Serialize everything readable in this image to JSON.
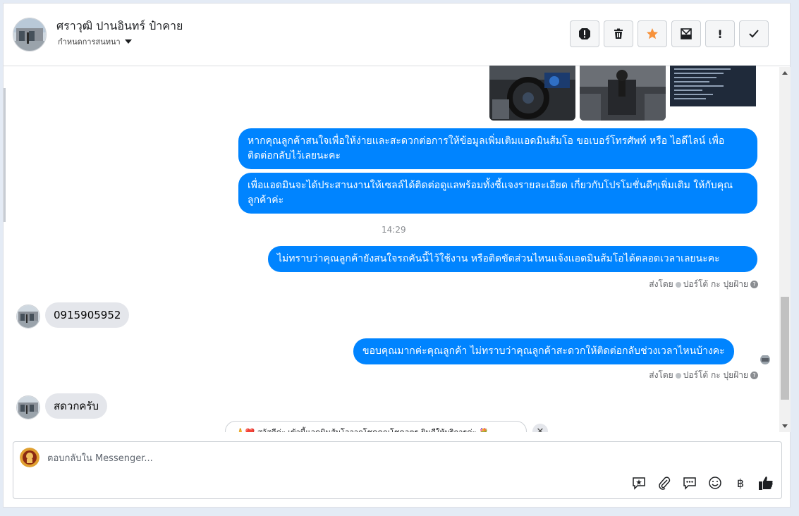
{
  "header": {
    "contact_name": "ศราวุฒิ ปานอินทร์ ป๋าคาย",
    "assign_label": "กำหนดการสนทนา",
    "actions": [
      {
        "name": "spam-button",
        "icon": "alert-octagon-icon",
        "glyph": "!"
      },
      {
        "name": "delete-button",
        "icon": "trash-icon",
        "glyph": "🗑"
      },
      {
        "name": "star-button",
        "icon": "star-icon",
        "glyph": "★"
      },
      {
        "name": "mark-unread-button",
        "icon": "envelope-icon",
        "glyph": "✉"
      },
      {
        "name": "follow-up-button",
        "icon": "exclamation-icon",
        "glyph": "!"
      },
      {
        "name": "done-button",
        "icon": "check-icon",
        "glyph": "✓"
      }
    ]
  },
  "colors": {
    "brand_blue": "#0084ff",
    "incoming_bubble": "#e4e6eb",
    "star_orange": "#f7923b"
  },
  "messages": {
    "out_1": "หากคุณลูกค้าสนใจเพื่อให้ง่ายและสะดวกต่อการให้ข้อมูลเพิ่มเติมแอดมินส้มโอ ขอเบอร์โทรศัพท์ หรือ ไอดีไลน์ เพื่อติดต่อกลับไว้เลยนะคะ",
    "out_2": "เพื่อแอดมินจะได้ประสานงานให้เซลล์ได้ติดต่อดูแลพร้อมทั้งชี้แจงรายละเอียด เกี่ยวกับโปรโมชั่นดีๆเพิ่มเติม ให้กับคุณลูกค้าค่ะ",
    "time_1": "14:29",
    "out_3": "ไม่ทราบว่าคุณลูกค้ายังสนใจรถคันนี้ไว้ใช้งาน หรือติดขัดส่วนไหนแจ้งแอดมินส้มโอได้ตลอดเวลาเลยนะคะ",
    "sent_by_1": "ส่งโดย",
    "sender_1": "ปอร์โต้ กะ ปุยฝ้าย",
    "in_1": "0915905952",
    "out_4": "ขอบคุณมากค่ะคุณลูกค้า ไม่ทราบว่าคุณลูกค้าสะดวกให้ติดต่อกลับช่วงเวลาไหนบ้างคะ",
    "sent_by_2": "ส่งโดย",
    "sender_2": "ปอร์โต้ กะ ปุยฝ้าย",
    "in_2": "สดวกครับ"
  },
  "greeting_chip": "🙏❤️ สวัสดีค่ะ เข้านี้แอดมินส้มโอจากโชคคูณโชคอตร ยินดีให้บริการค่ะ 💐.",
  "composer": {
    "placeholder": "ตอบกลับใน Messenger...",
    "tools": [
      {
        "name": "saved-reply-button",
        "icon": "chat-star-icon",
        "glyph": "✦"
      },
      {
        "name": "attach-button",
        "icon": "paperclip-icon",
        "glyph": "📎"
      },
      {
        "name": "quick-reply-button",
        "icon": "chat-bubble-icon",
        "glyph": "💬"
      },
      {
        "name": "emoji-button",
        "icon": "smiley-icon",
        "glyph": "☺"
      },
      {
        "name": "payment-button",
        "icon": "baht-icon",
        "glyph": "฿"
      },
      {
        "name": "like-button",
        "icon": "thumbs-up-icon",
        "glyph": "👍"
      }
    ]
  }
}
